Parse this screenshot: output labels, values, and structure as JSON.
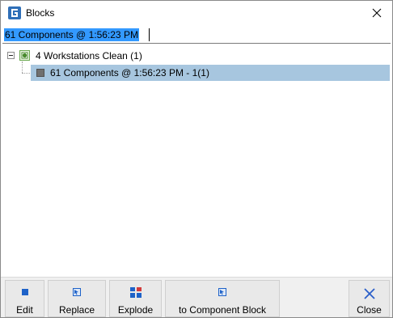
{
  "window": {
    "title": "Blocks",
    "app_icon": "app-logo-icon",
    "close_icon": "close-icon"
  },
  "search": {
    "value": "61 Components @ 1:56:23 PM",
    "selected": true
  },
  "tree": {
    "root": {
      "label": "4 Workstations Clean (1)",
      "expanded": true,
      "icon": "group-block-icon",
      "children": [
        {
          "label": "61 Components @ 1:56:23 PM - 1(1)",
          "selected": true,
          "icon": "block-item-icon"
        }
      ]
    }
  },
  "toolbar": {
    "edit_label": "Edit",
    "replace_label": "Replace",
    "explode_label": "Explode",
    "to_component_label": "to Component Block",
    "close_label": "Close"
  },
  "colors": {
    "selection": "#a7c6df",
    "text_highlight": "#3399ff",
    "icon_blue": "#1e62c8",
    "close_blue": "#2a5ec9"
  }
}
